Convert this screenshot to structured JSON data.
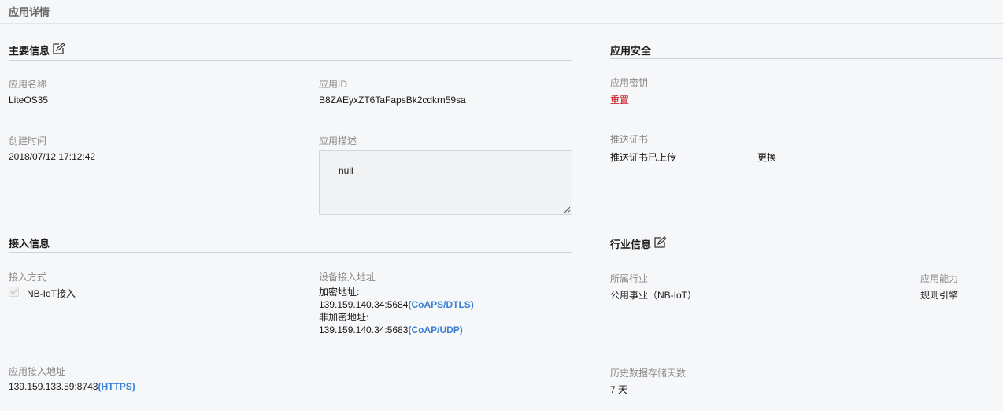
{
  "page_title": "应用详情",
  "main_info": {
    "title": "主要信息",
    "app_name_label": "应用名称",
    "app_name": "LiteOS35",
    "app_id_label": "应用ID",
    "app_id": "B8ZAEyxZT6TaFapsBk2cdkrn59sa",
    "created_label": "创建时间",
    "created": "2018/07/12 17:12:42",
    "desc_label": "应用描述",
    "desc": "null"
  },
  "security": {
    "title": "应用安全",
    "key_label": "应用密钥",
    "reset": "重置",
    "cert_label": "推送证书",
    "cert_status": "推送证书已上传",
    "replace": "更换"
  },
  "access": {
    "title": "接入信息",
    "method_label": "接入方式",
    "method": "NB-IoT接入",
    "method_checked": true,
    "device_addr_label": "设备接入地址",
    "enc_label": "加密地址:",
    "enc_addr": "139.159.140.34:5684",
    "enc_proto": "(CoAPS/DTLS)",
    "plain_label": "非加密地址:",
    "plain_addr": "139.159.140.34:5683",
    "plain_proto": "(CoAP/UDP)",
    "app_addr_label": "应用接入地址",
    "app_addr": "139.159.133.59:8743",
    "app_proto": "(HTTPS)"
  },
  "industry": {
    "title": "行业信息",
    "industry_label": "所属行业",
    "industry": "公用事业（NB-IoT）",
    "capability_label": "应用能力",
    "capability": "规则引擎",
    "history_label": "历史数据存储天数:",
    "history": "7 天"
  },
  "colors": {
    "accent_red": "#c7000b",
    "link_blue": "#3a7fd5"
  },
  "icons": [
    "edit-icon",
    "checkmark-icon",
    "resize-handle-icon"
  ]
}
